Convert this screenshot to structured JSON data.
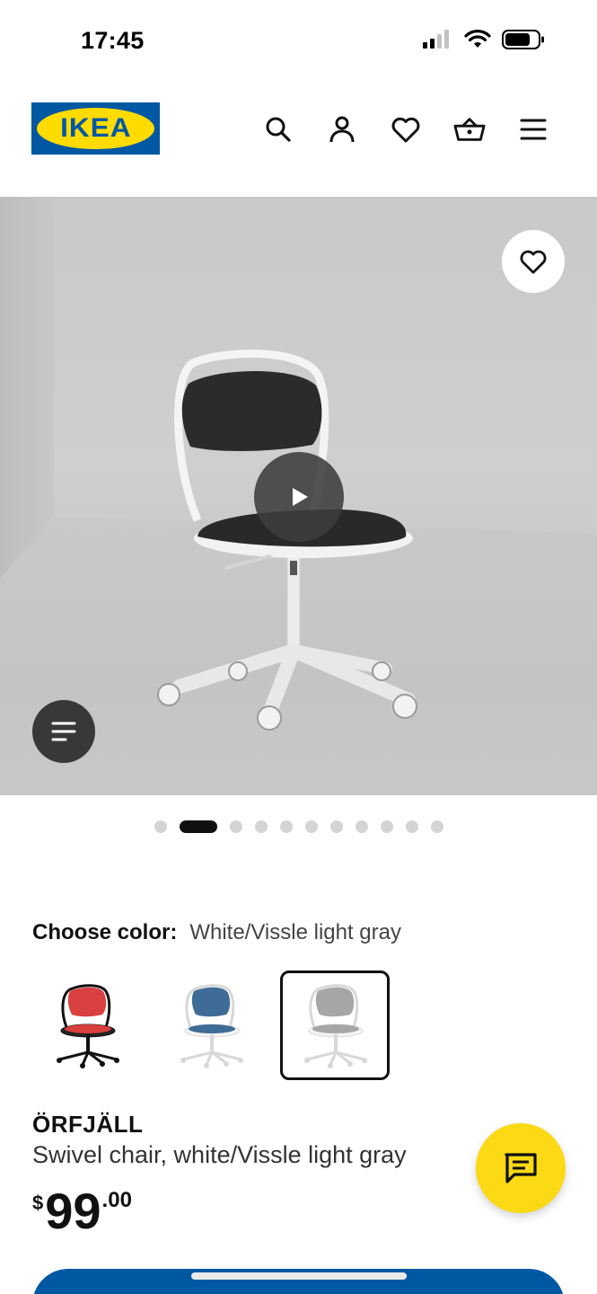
{
  "status_bar": {
    "time": "17:45"
  },
  "header": {
    "logo_text": "IKEA",
    "icons": [
      "search-icon",
      "account-icon",
      "heart-icon",
      "cart-icon",
      "menu-icon"
    ]
  },
  "hero": {
    "carousel": {
      "total": 11,
      "active_index": 1
    },
    "icons": [
      "heart-icon",
      "play-icon",
      "info-lines-icon"
    ]
  },
  "color_chooser": {
    "label": "Choose color:",
    "selected_value": "White/Vissle light gray",
    "options": [
      {
        "name": "red-black",
        "seat_color": "#d9403f",
        "frame_color": "#1a1a1a",
        "selected": false
      },
      {
        "name": "blue-white",
        "seat_color": "#3f6c96",
        "frame_color": "#ffffff",
        "selected": false
      },
      {
        "name": "white-light-gray",
        "seat_color": "#a6a6a8",
        "frame_color": "#ffffff",
        "selected": true
      }
    ]
  },
  "product": {
    "name": "ÖRFJÄLL",
    "description": "Swivel chair, white/Vissle light gray",
    "price": {
      "currency": "$",
      "integer": "99",
      "decimal": ".00"
    }
  },
  "colors": {
    "brand_blue": "#0058a3",
    "brand_yellow": "#ffdb00",
    "chat_yellow": "#fbd914"
  }
}
